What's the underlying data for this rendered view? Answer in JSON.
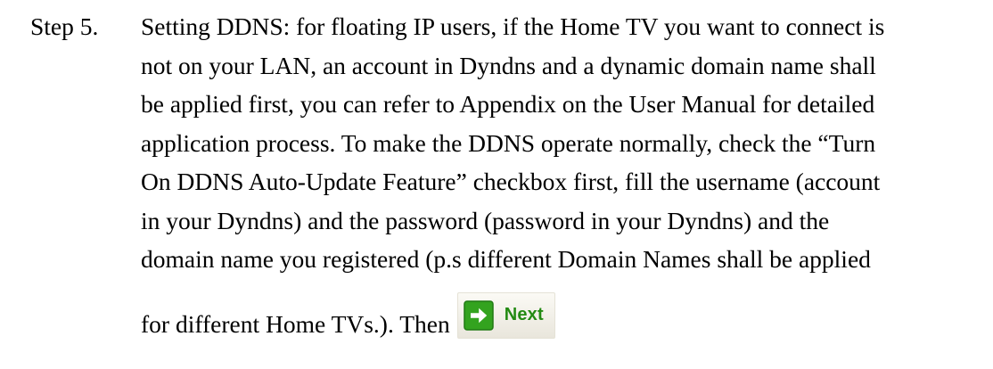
{
  "step": {
    "label": "Step 5.",
    "lines": [
      "Setting DDNS: for floating IP users, if the Home TV you want to connect is",
      "not on your LAN, an account in Dyndns and a dynamic domain name shall",
      "be applied first, you can refer to Appendix on the User Manual for detailed",
      "application process. To make the DDNS operate normally, check the “Turn",
      "On DDNS Auto-Update Feature” checkbox first, fill the username (account",
      "in your Dyndns) and the password (password in your Dyndns) and the",
      "domain name you registered (p.s different Domain Names shall be applied"
    ],
    "last_line": "for different Home TVs.). Then"
  },
  "next_button": {
    "label": "Next",
    "icon": "green-right-arrow-icon",
    "text_color": "#238a13",
    "icon_color": "#33a31f"
  }
}
